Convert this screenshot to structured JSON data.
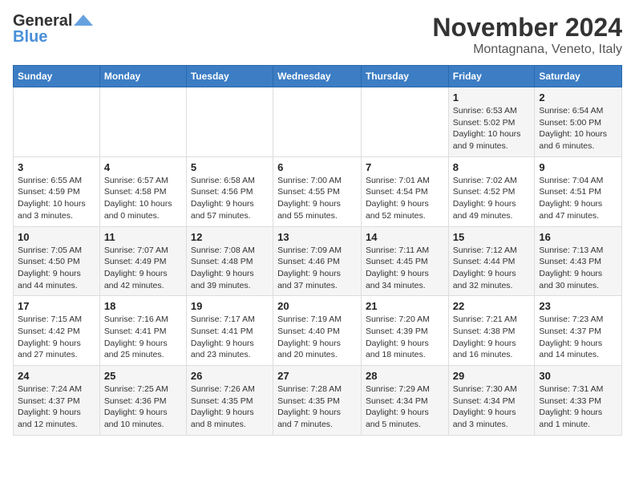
{
  "logo": {
    "general": "General",
    "blue": "Blue"
  },
  "title": "November 2024",
  "location": "Montagnana, Veneto, Italy",
  "headers": [
    "Sunday",
    "Monday",
    "Tuesday",
    "Wednesday",
    "Thursday",
    "Friday",
    "Saturday"
  ],
  "weeks": [
    [
      {
        "day": "",
        "info": ""
      },
      {
        "day": "",
        "info": ""
      },
      {
        "day": "",
        "info": ""
      },
      {
        "day": "",
        "info": ""
      },
      {
        "day": "",
        "info": ""
      },
      {
        "day": "1",
        "info": "Sunrise: 6:53 AM\nSunset: 5:02 PM\nDaylight: 10 hours and 9 minutes."
      },
      {
        "day": "2",
        "info": "Sunrise: 6:54 AM\nSunset: 5:00 PM\nDaylight: 10 hours and 6 minutes."
      }
    ],
    [
      {
        "day": "3",
        "info": "Sunrise: 6:55 AM\nSunset: 4:59 PM\nDaylight: 10 hours and 3 minutes."
      },
      {
        "day": "4",
        "info": "Sunrise: 6:57 AM\nSunset: 4:58 PM\nDaylight: 10 hours and 0 minutes."
      },
      {
        "day": "5",
        "info": "Sunrise: 6:58 AM\nSunset: 4:56 PM\nDaylight: 9 hours and 57 minutes."
      },
      {
        "day": "6",
        "info": "Sunrise: 7:00 AM\nSunset: 4:55 PM\nDaylight: 9 hours and 55 minutes."
      },
      {
        "day": "7",
        "info": "Sunrise: 7:01 AM\nSunset: 4:54 PM\nDaylight: 9 hours and 52 minutes."
      },
      {
        "day": "8",
        "info": "Sunrise: 7:02 AM\nSunset: 4:52 PM\nDaylight: 9 hours and 49 minutes."
      },
      {
        "day": "9",
        "info": "Sunrise: 7:04 AM\nSunset: 4:51 PM\nDaylight: 9 hours and 47 minutes."
      }
    ],
    [
      {
        "day": "10",
        "info": "Sunrise: 7:05 AM\nSunset: 4:50 PM\nDaylight: 9 hours and 44 minutes."
      },
      {
        "day": "11",
        "info": "Sunrise: 7:07 AM\nSunset: 4:49 PM\nDaylight: 9 hours and 42 minutes."
      },
      {
        "day": "12",
        "info": "Sunrise: 7:08 AM\nSunset: 4:48 PM\nDaylight: 9 hours and 39 minutes."
      },
      {
        "day": "13",
        "info": "Sunrise: 7:09 AM\nSunset: 4:46 PM\nDaylight: 9 hours and 37 minutes."
      },
      {
        "day": "14",
        "info": "Sunrise: 7:11 AM\nSunset: 4:45 PM\nDaylight: 9 hours and 34 minutes."
      },
      {
        "day": "15",
        "info": "Sunrise: 7:12 AM\nSunset: 4:44 PM\nDaylight: 9 hours and 32 minutes."
      },
      {
        "day": "16",
        "info": "Sunrise: 7:13 AM\nSunset: 4:43 PM\nDaylight: 9 hours and 30 minutes."
      }
    ],
    [
      {
        "day": "17",
        "info": "Sunrise: 7:15 AM\nSunset: 4:42 PM\nDaylight: 9 hours and 27 minutes."
      },
      {
        "day": "18",
        "info": "Sunrise: 7:16 AM\nSunset: 4:41 PM\nDaylight: 9 hours and 25 minutes."
      },
      {
        "day": "19",
        "info": "Sunrise: 7:17 AM\nSunset: 4:41 PM\nDaylight: 9 hours and 23 minutes."
      },
      {
        "day": "20",
        "info": "Sunrise: 7:19 AM\nSunset: 4:40 PM\nDaylight: 9 hours and 20 minutes."
      },
      {
        "day": "21",
        "info": "Sunrise: 7:20 AM\nSunset: 4:39 PM\nDaylight: 9 hours and 18 minutes."
      },
      {
        "day": "22",
        "info": "Sunrise: 7:21 AM\nSunset: 4:38 PM\nDaylight: 9 hours and 16 minutes."
      },
      {
        "day": "23",
        "info": "Sunrise: 7:23 AM\nSunset: 4:37 PM\nDaylight: 9 hours and 14 minutes."
      }
    ],
    [
      {
        "day": "24",
        "info": "Sunrise: 7:24 AM\nSunset: 4:37 PM\nDaylight: 9 hours and 12 minutes."
      },
      {
        "day": "25",
        "info": "Sunrise: 7:25 AM\nSunset: 4:36 PM\nDaylight: 9 hours and 10 minutes."
      },
      {
        "day": "26",
        "info": "Sunrise: 7:26 AM\nSunset: 4:35 PM\nDaylight: 9 hours and 8 minutes."
      },
      {
        "day": "27",
        "info": "Sunrise: 7:28 AM\nSunset: 4:35 PM\nDaylight: 9 hours and 7 minutes."
      },
      {
        "day": "28",
        "info": "Sunrise: 7:29 AM\nSunset: 4:34 PM\nDaylight: 9 hours and 5 minutes."
      },
      {
        "day": "29",
        "info": "Sunrise: 7:30 AM\nSunset: 4:34 PM\nDaylight: 9 hours and 3 minutes."
      },
      {
        "day": "30",
        "info": "Sunrise: 7:31 AM\nSunset: 4:33 PM\nDaylight: 9 hours and 1 minute."
      }
    ]
  ]
}
